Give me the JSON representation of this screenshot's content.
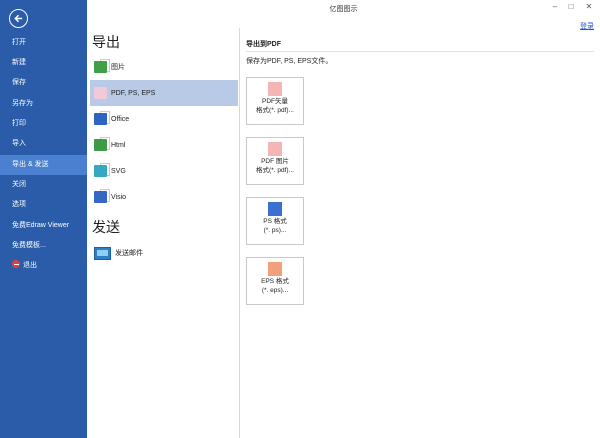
{
  "window": {
    "title": "亿图图示",
    "login": "登录"
  },
  "sidebar": {
    "items": [
      {
        "label": "打开"
      },
      {
        "label": "新建"
      },
      {
        "label": "保存"
      },
      {
        "label": "另存为"
      },
      {
        "label": "打印"
      },
      {
        "label": "导入"
      },
      {
        "label": "导出 & 发送",
        "active": true
      },
      {
        "label": "关闭"
      },
      {
        "label": "选项"
      },
      {
        "label": "免费Edraw Viewer"
      },
      {
        "label": "免费模板..."
      },
      {
        "label": "退出"
      }
    ]
  },
  "export_section": {
    "heading": "导出",
    "options": [
      {
        "label": "图片"
      },
      {
        "label": "PDF, PS, EPS",
        "active": true
      },
      {
        "label": "Office"
      },
      {
        "label": "Html"
      },
      {
        "label": "SVG"
      },
      {
        "label": "Visio"
      }
    ]
  },
  "send_section": {
    "heading": "发送",
    "options": [
      {
        "label": "发送邮件"
      }
    ]
  },
  "right_panel": {
    "title": "导出到PDF",
    "description": "保存为PDF, PS, EPS文件。",
    "buttons": [
      {
        "label": "PDF矢量\n格式(*. pdf)..."
      },
      {
        "label": "PDF 图片\n格式(*. pdf)..."
      },
      {
        "label": "PS 格式\n(*. ps)..."
      },
      {
        "label": "EPS 格式\n(*. eps)..."
      }
    ]
  }
}
